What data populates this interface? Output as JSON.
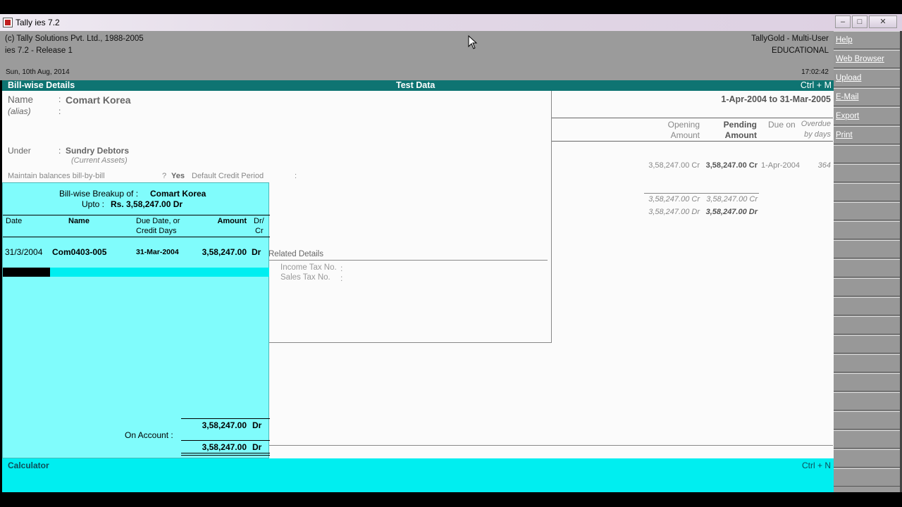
{
  "window": {
    "title": "Tally ies 7.2"
  },
  "info": {
    "copyright": "(c) Tally Solutions Pvt. Ltd., 1988-2005",
    "release": "ies 7.2 - Release 1",
    "date": "Sun, 10th Aug, 2014",
    "edition": "TallyGold - Multi-User",
    "mode": "EDUCATIONAL",
    "time": "17:02:42"
  },
  "header": {
    "screen": "Bill-wise Details",
    "company": "Test Data",
    "shortcut": "Ctrl + M"
  },
  "ledger": {
    "name_label": "Name",
    "name_value": "Comart Korea",
    "alias_label": "(alias)",
    "under_label": "Under",
    "under_value": "Sundry Debtors",
    "under_group": "(Current Assets)",
    "billwise_label": "Maintain balances bill-by-bill",
    "billwise_value": "Yes",
    "credit_period_label": "Default Credit Period",
    "related_label": "Related Details",
    "income_tax_label": "Income Tax No.",
    "sales_tax_label": "Sales Tax No."
  },
  "report": {
    "period": "1-Apr-2004 to 31-Mar-2005",
    "col_opening": "Opening",
    "col_opening2": "Amount",
    "col_pending": "Pending",
    "col_pending2": "Amount",
    "col_dueon": "Due on",
    "col_overdue": "Overdue",
    "col_overdue2": "by days",
    "row_opening": "3,58,247.00 Cr",
    "row_pending": "3,58,247.00 Cr",
    "row_dueon": "1-Apr-2004",
    "row_overdue": "364",
    "sub_opening": "3,58,247.00 Cr",
    "sub_pending": "3,58,247.00 Cr",
    "tot_opening": "3,58,247.00 Dr",
    "tot_pending": "3,58,247.00 Dr"
  },
  "popup": {
    "title_prefix": "Bill-wise Breakup of :",
    "title_party": "Comart Korea",
    "upto_prefix": "Upto :",
    "upto_amount": "Rs. 3,58,247.00 Dr",
    "col_date": "Date",
    "col_name": "Name",
    "col_due": "Due Date, or",
    "col_due2": "Credit Days",
    "col_amount": "Amount",
    "col_drcr": "Dr/",
    "col_drcr2": "Cr",
    "row_date": "31/3/2004",
    "row_name": "Com0403-005",
    "row_due": "31-Mar-2004",
    "row_amount": "3,58,247.00",
    "row_drcr": "Dr",
    "onaccount_amount": "3,58,247.00",
    "onaccount_drcr": "Dr",
    "onaccount_label": "On Account :",
    "total_amount": "3,58,247.00",
    "total_drcr": "Dr"
  },
  "calc": {
    "label": "Calculator",
    "shortcut": "Ctrl + N"
  },
  "sidebar": [
    "Help",
    "Web Browser",
    "Upload",
    "E-Mail",
    "Export",
    "Print"
  ],
  "colors": {
    "teal_header": "#0e7472",
    "popup_bg": "#80fcfc",
    "calc_bg": "#00eef0"
  }
}
